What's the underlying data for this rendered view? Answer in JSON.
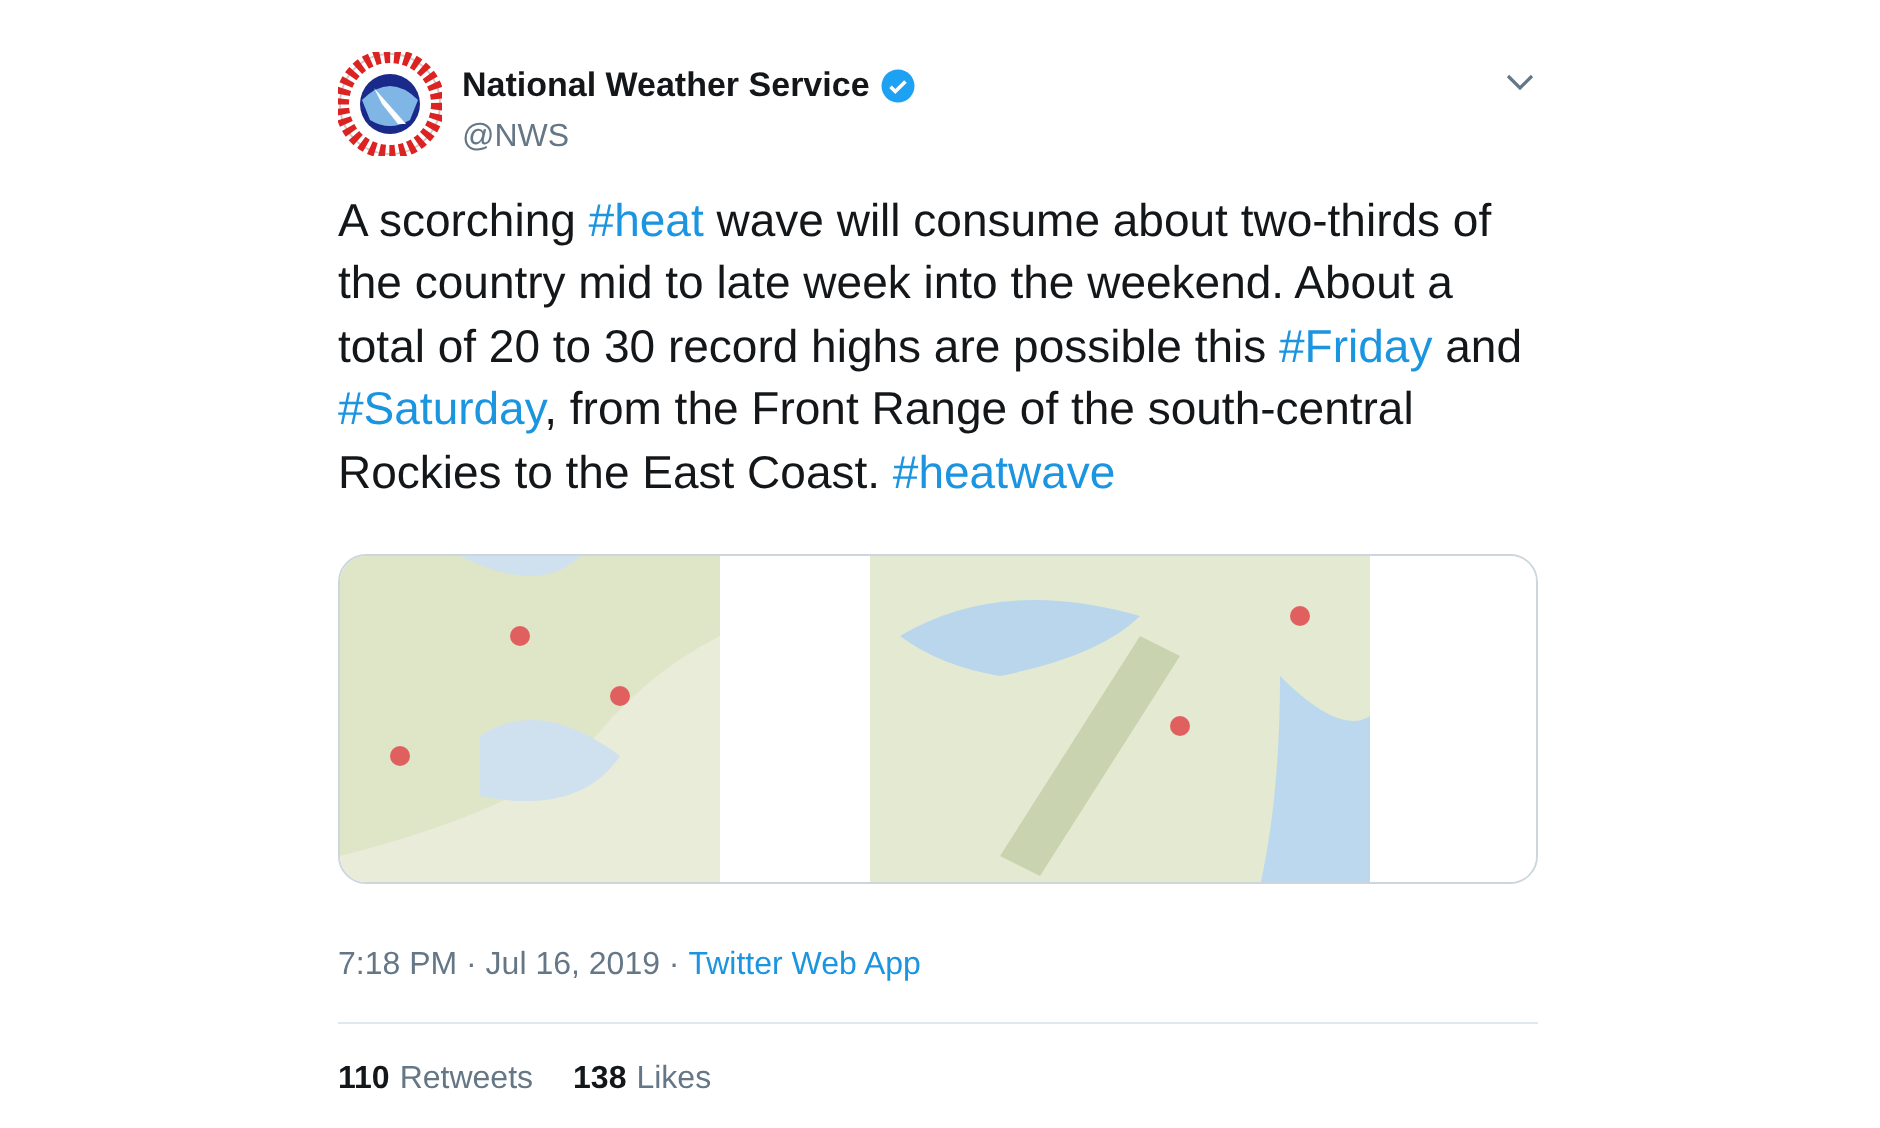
{
  "author": {
    "name": "National Weather Service",
    "handle": "@NWS",
    "verified": true
  },
  "tweet": {
    "segments": [
      {
        "kind": "text",
        "text": "A scorching "
      },
      {
        "kind": "hashtag",
        "text": "#heat"
      },
      {
        "kind": "text",
        "text": " wave will consume about two-thirds of the country mid to late week into the weekend. About a total of 20 to 30 record highs are possible this "
      },
      {
        "kind": "hashtag",
        "text": "#Friday"
      },
      {
        "kind": "text",
        "text": " and "
      },
      {
        "kind": "hashtag",
        "text": "#Saturday"
      },
      {
        "kind": "text",
        "text": ", from the Front Range of the south-central Rockies to the East Coast. "
      },
      {
        "kind": "hashtag",
        "text": "#heatwave"
      }
    ]
  },
  "meta": {
    "timestamp": "7:18 PM · Jul 16, 2019 · ",
    "source": "Twitter Web App"
  },
  "stats": [
    {
      "count": "110",
      "label": "Retweets"
    },
    {
      "count": "138",
      "label": "Likes"
    }
  ]
}
